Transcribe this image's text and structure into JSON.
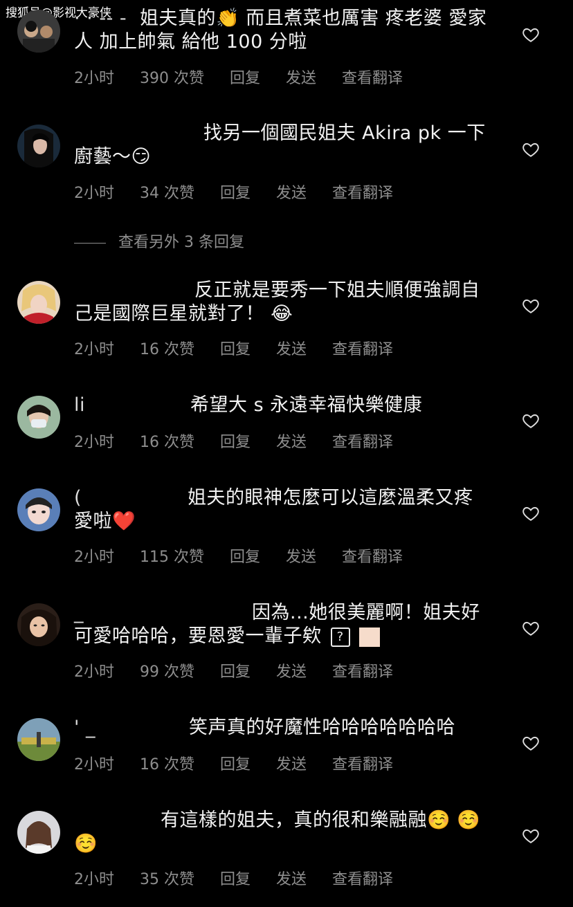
{
  "watermark": "搜狐号@影视大豪侠",
  "more_replies": "查看另外 3 条回复",
  "comments": [
    {
      "username": "· · -- -",
      "text": "姐夫真的👏 而且煮菜也厲害 疼老婆 愛家人 加上帥氣 給他 100 分啦",
      "time": "2小时",
      "likes": "390 次赞",
      "reply": "回复",
      "send": "发送",
      "translate": "查看翻译"
    },
    {
      "username": "",
      "text": "找另一個國民姐夫 Akira pk 一下 廚藝～😏",
      "time": "2小时",
      "likes": "34 次赞",
      "reply": "回复",
      "send": "发送",
      "translate": "查看翻译"
    },
    {
      "username": "",
      "text": "反正就是要秀一下姐夫順便強調自己是國際巨星就對了！ 😂",
      "time": "2小时",
      "likes": "16 次赞",
      "reply": "回复",
      "send": "发送",
      "translate": "查看翻译"
    },
    {
      "username": "li",
      "text": "希望大 s 永遠幸福快樂健康",
      "time": "2小时",
      "likes": "16 次赞",
      "reply": "回复",
      "send": "发送",
      "translate": "查看翻译"
    },
    {
      "username": "(",
      "text": "姐夫的眼神怎麼可以這麼溫柔又疼愛啦❤️",
      "time": "2小时",
      "likes": "115 次赞",
      "reply": "回复",
      "send": "发送",
      "translate": "查看翻译"
    },
    {
      "username": "_",
      "text": "因為...她很美麗啊！姐夫好可愛哈哈哈，要恩愛一輩子欸",
      "time": "2小时",
      "likes": "99 次赞",
      "reply": "回复",
      "send": "发送",
      "translate": "查看翻译"
    },
    {
      "username": "' _",
      "text": "笑声真的好魔性哈哈哈哈哈哈哈",
      "time": "2小时",
      "likes": "16 次赞",
      "reply": "回复",
      "send": "发送",
      "translate": "查看翻译"
    },
    {
      "username": "",
      "text": "有這樣的姐夫，真的很和樂融融☺️ ☺️ ☺️",
      "time": "2小时",
      "likes": "35 次赞",
      "reply": "回复",
      "send": "发送",
      "translate": "查看翻译"
    }
  ],
  "colors": {
    "background": "#000000",
    "text": "#f2f2f2",
    "meta": "#8e8e8e"
  },
  "icons": {
    "like": "heart-outline-icon"
  }
}
